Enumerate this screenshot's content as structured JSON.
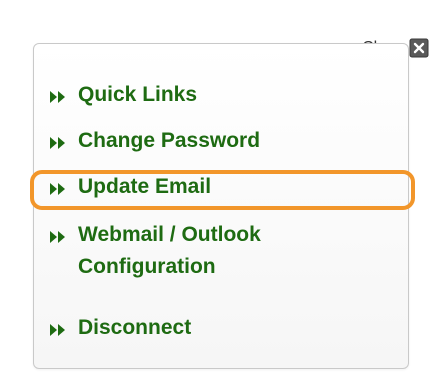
{
  "header": {
    "close_label": "Close"
  },
  "icons": {
    "close": "close-box-icon",
    "bullet": "double-arrow-right-icon"
  },
  "menu": {
    "items": [
      {
        "label": "Quick Links"
      },
      {
        "label": "Change Password"
      },
      {
        "label": "Update Email",
        "highlighted": true
      },
      {
        "label": "Webmail / Outlook Configuration"
      },
      {
        "label": "Disconnect"
      }
    ]
  },
  "colors": {
    "link_green": "#1e6b12",
    "highlight_orange": "#f2962a",
    "panel_border": "#c9c9c9"
  }
}
